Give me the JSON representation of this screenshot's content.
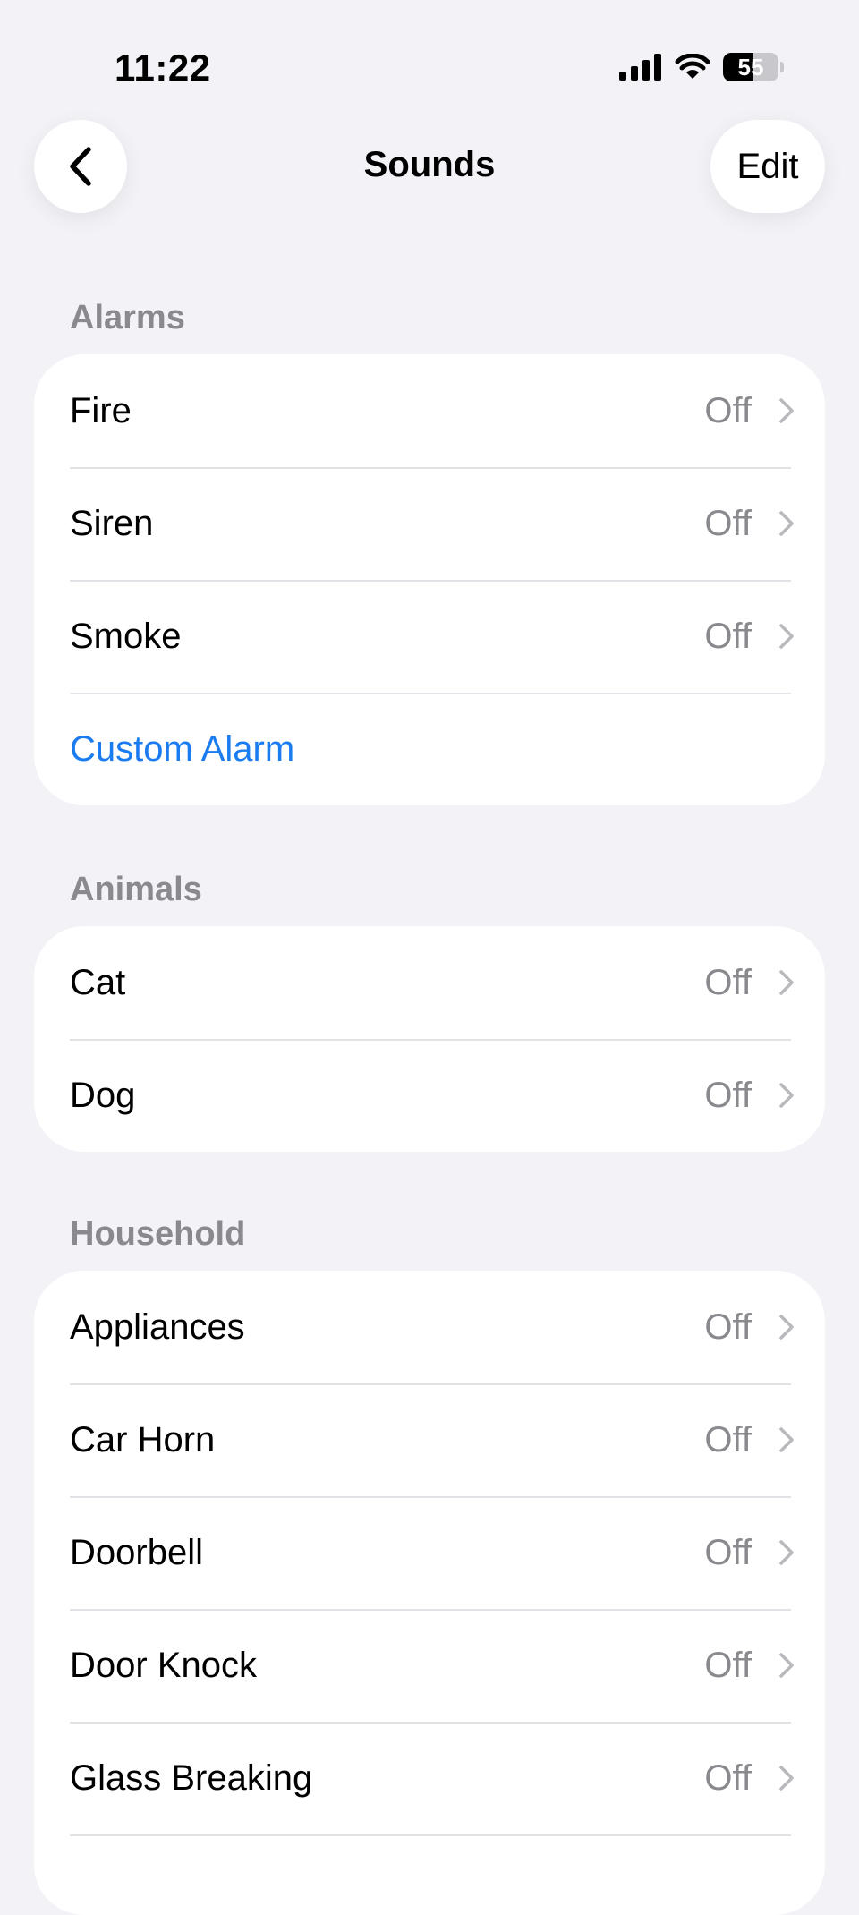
{
  "status_bar": {
    "time": "11:22",
    "battery_level": "55",
    "battery_fraction": 0.55,
    "icons": [
      "cellular-signal-icon",
      "wifi-icon",
      "battery-icon"
    ]
  },
  "nav": {
    "title": "Sounds",
    "edit_label": "Edit",
    "back_icon": "chevron-left-icon"
  },
  "colors": {
    "background": "#f2f2f7",
    "card": "#ffffff",
    "link": "#1a7cf0",
    "secondary_text": "#8a8a8e"
  },
  "sections": [
    {
      "header": "Alarms",
      "items": [
        {
          "label": "Fire",
          "value": "Off"
        },
        {
          "label": "Siren",
          "value": "Off"
        },
        {
          "label": "Smoke",
          "value": "Off"
        },
        {
          "label": "Custom Alarm",
          "value": ""
        }
      ]
    },
    {
      "header": "Animals",
      "items": [
        {
          "label": "Cat",
          "value": "Off"
        },
        {
          "label": "Dog",
          "value": "Off"
        }
      ]
    },
    {
      "header": "Household",
      "items": [
        {
          "label": "Appliances",
          "value": "Off"
        },
        {
          "label": "Car Horn",
          "value": "Off"
        },
        {
          "label": "Doorbell",
          "value": "Off"
        },
        {
          "label": "Door Knock",
          "value": "Off"
        },
        {
          "label": "Glass Breaking",
          "value": "Off"
        },
        {
          "label": "",
          "value": ""
        }
      ]
    }
  ]
}
